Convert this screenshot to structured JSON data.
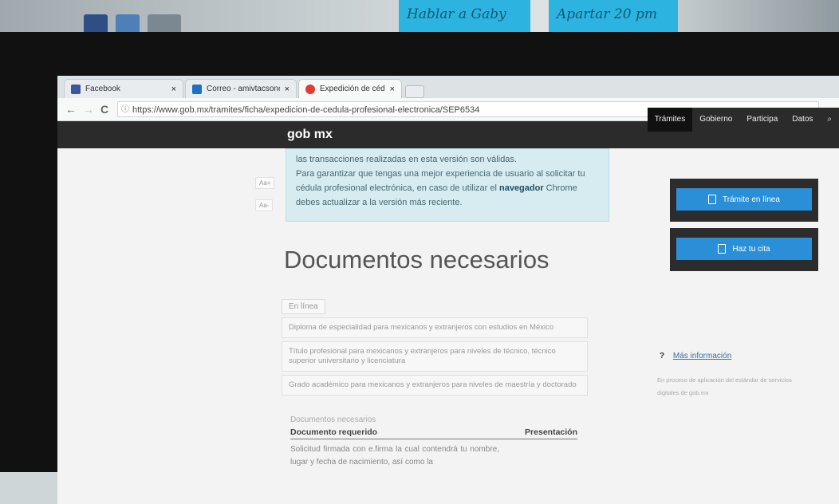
{
  "stickies": {
    "left": "Hablar a Gaby",
    "right": "Apartar 20 pm"
  },
  "tabs": [
    {
      "title": "Facebook",
      "close": "×"
    },
    {
      "title": "Correo - amivtacsonora@",
      "close": "×"
    },
    {
      "title": "Expedición de cédula pro",
      "close": "×"
    }
  ],
  "address_bar": {
    "back": "←",
    "forward": "→",
    "reload": "C",
    "info": "ⓘ",
    "url": "https://www.gob.mx/tramites/ficha/expedicion-de-cedula-profesional-electronica/SEP6534"
  },
  "site": {
    "logo": "gob mx",
    "nav": [
      "Trámites",
      "Gobierno",
      "Participa",
      "Datos"
    ],
    "search_glyph": "⌕"
  },
  "notice": {
    "line1": "las transacciones realizadas en esta versión son válidas.",
    "line2_pre": "Para garantizar que tengas una mejor experiencia de usuario al solicitar tu cédula profesional electrónica, en caso de utilizar el ",
    "line2_bold": "navegador",
    "line2_post": " Chrome debes actualizar a la versión más reciente."
  },
  "font_controls": {
    "increase": "Aa+",
    "decrease": "Aa-"
  },
  "page_title": "Documentos necesarios",
  "documents": {
    "chip": "En línea",
    "items": [
      "Diploma de especialidad para mexicanos y extranjeros con estudios en México",
      "Título profesional para mexicanos y extranjeros para niveles de técnico, técnico superior universitario y licenciatura",
      "Grado académico para mexicanos y extranjeros para niveles de maestría y doctorado"
    ]
  },
  "table": {
    "title": "Documentos necesarios",
    "col1": "Documento requerido",
    "col2": "Presentación",
    "row1": "Solicitud firmada con e.firma la cual contendrá tu nombre, lugar y fecha de nacimiento, así como la"
  },
  "sidebar": {
    "btn1": "Trámite en línea",
    "btn2": "Haz tu cita",
    "more_q": "?",
    "more_link": "Más información",
    "footnote": "En proceso de aplicación del estándar de servicios digitales de gob.mx"
  }
}
